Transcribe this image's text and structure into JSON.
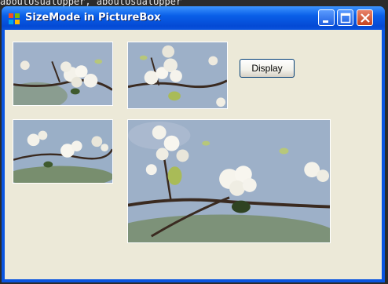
{
  "background_text": "aboutUsualUpper, aboutUsualUpper",
  "window": {
    "title": "SizeMode in PictureBox",
    "icon": "winforms-app-icon",
    "controls": [
      "minimize-icon",
      "maximize-icon",
      "close-icon"
    ]
  },
  "buttons": {
    "display_label": "Display"
  },
  "picture_boxes": [
    {
      "name": "picturebox-1",
      "size_mode": "stretched"
    },
    {
      "name": "picturebox-2",
      "size_mode": "normal"
    },
    {
      "name": "picturebox-3",
      "size_mode": "auto-ish"
    },
    {
      "name": "picturebox-4",
      "size_mode": "zoom"
    }
  ],
  "colors": {
    "titlebar": "#0a5fe8",
    "client_bg": "#ece9d8",
    "close_button": "#c4431f"
  }
}
